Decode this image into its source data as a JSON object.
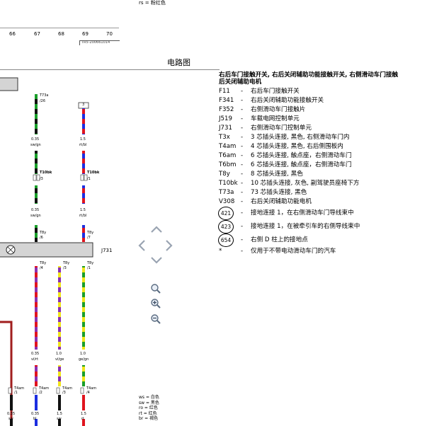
{
  "page": {
    "title": "电路图"
  },
  "header": {
    "rs_label": "rs",
    "rs_value": "= 粉红色",
    "ruler": [
      "66",
      "67",
      "68",
      "69",
      "70"
    ],
    "ref_code": "TR5-200661014"
  },
  "legend": {
    "title_line1": "右后车门接触开关, 右后关闭辅助功能接触开关, 右侧滑动车门接触",
    "title_line2": "后关闭辅助电机",
    "items": [
      {
        "code": "F11",
        "desc": "右后车门接触开关"
      },
      {
        "code": "F341",
        "desc": "右后关闭辅助功能接触开关"
      },
      {
        "code": "F352",
        "desc": "右侧滑动车门接触片"
      },
      {
        "code": "J519",
        "desc": "车载电网控制单元"
      },
      {
        "code": "J731",
        "desc": "右侧滑动车门控制单元"
      },
      {
        "code": "T3x",
        "desc": "3 芯插头连接, 黑色, 右侧滑动车门内"
      },
      {
        "code": "T4am",
        "desc": "4 芯插头连接, 黑色, 右后侧围板内"
      },
      {
        "code": "T6am",
        "desc": "6 芯插头连接, 触点座，右侧滑动车门"
      },
      {
        "code": "T6bm",
        "desc": "6 芯插头连接, 触点座，右侧滑动车门"
      },
      {
        "code": "T8y",
        "desc": "8 芯插头连接, 黑色"
      },
      {
        "code": "T10bk",
        "desc": "10 芯插头连接, 灰色, 副驾驶员座椅下方"
      },
      {
        "code": "T73a",
        "desc": "73 芯插头连接, 黑色"
      },
      {
        "code": "V308",
        "desc": "右后关闭辅助功能电机"
      }
    ],
    "grounds": [
      {
        "code": "421",
        "desc": "接地连接 1，在右侧滑动车门导线束中"
      },
      {
        "code": "423",
        "desc": "接地连接 1，在被牵引车的右侧导线束中"
      },
      {
        "code": "654",
        "desc": "右侧 D 柱上的接地点"
      }
    ],
    "footnote": {
      "code": "*",
      "desc": "仅用于不带电动滑动车门的汽车"
    }
  },
  "diagram": {
    "t73a_label": "T73a",
    "t73a_pin": "/26",
    "box3": "3",
    "wire1": {
      "size": "0.35",
      "color": "sw/gn"
    },
    "wire2": {
      "size": "1.5",
      "color": "rt/bl"
    },
    "t10bk_a": "T10bk",
    "t10bk_a_pin": "/3",
    "t10bk_b": "T10bk",
    "t10bk_b_pin": "/1",
    "wire3": {
      "size": "0.35",
      "color": "sw/gn"
    },
    "wire4": {
      "size": "1.5",
      "color": "rt/bl"
    },
    "t8y_top1": "T8y",
    "t8y_top1_pin": "/6",
    "t8y_top2": "T8y",
    "t8y_top2_pin": "/7",
    "j731": "J731",
    "t8y_b1": "T8y",
    "t8y_b1_pin": "/4",
    "t8y_b2": "T8y",
    "t8y_b2_pin": "/3",
    "t8y_b3": "T8y",
    "t8y_b3_pin": "/1",
    "wire5": {
      "size": "0.35",
      "color": "vi/rt"
    },
    "wire6": {
      "size": "1.0",
      "color": "vi/ge"
    },
    "wire7": {
      "size": "1.0",
      "color": "ge/gn"
    },
    "t4am_1": "T4am",
    "t4am_1_pin": "/1",
    "t4am_2": "T4am",
    "t4am_2_pin": "/2",
    "t4am_3": "T4am",
    "t4am_3_pin": "/3",
    "t4am_4": "T4am",
    "t4am_4_pin": "/4",
    "wire8": {
      "size": "0.35",
      "color": "sw"
    },
    "wire9": {
      "size": "0.35",
      "color": "bl"
    },
    "wire10": {
      "size": "1.5",
      "color": "sw"
    },
    "wire11": {
      "size": "1.5",
      "color": "rt"
    }
  },
  "color_key": [
    "ws = 白色",
    "sw = 黑色",
    "ro = 红色",
    "rt = 红色",
    "br = 褐色"
  ],
  "colors": {
    "black": "#111111",
    "green": "#1a9e2a",
    "red": "#e0141e",
    "blue": "#1c2ee0",
    "violet": "#8b2fb0",
    "yellow": "#f2e51a",
    "gray_bar": "#d4d4d4",
    "dark_red": "#a01e1e"
  },
  "nav_icons": [
    "chevron-up-icon",
    "chevron-left-icon",
    "chevron-right-icon",
    "chevron-down-icon",
    "zoom-reset-icon",
    "zoom-in-icon",
    "zoom-out-icon"
  ]
}
